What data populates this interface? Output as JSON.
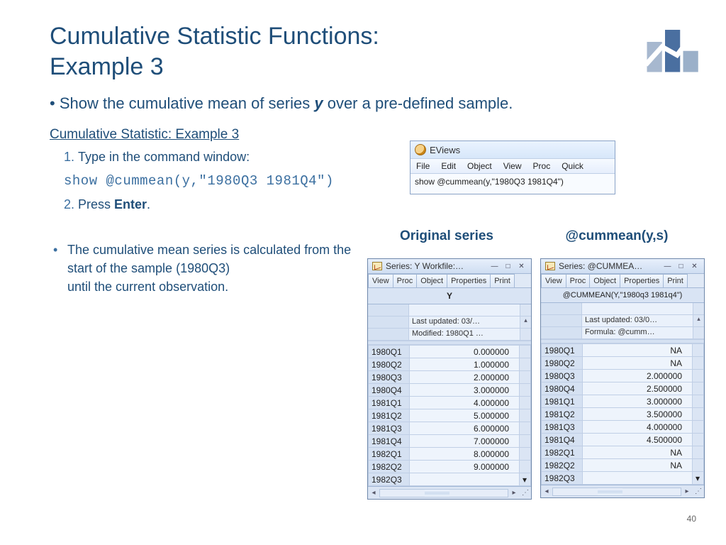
{
  "title_line1": "Cumulative Statistic Functions:",
  "title_line2": "Example 3",
  "main_bullet_pre": "Show the cumulative mean of series ",
  "main_bullet_var": "y",
  "main_bullet_post": " over a pre-defined sample.",
  "sub_heading": "Cumulative Statistic: Example 3",
  "step1": "Type in the command window:",
  "code_line": "show @cummean(y,\"1980Q3 1981Q4\")",
  "step2_pre": "Press ",
  "step2_key": "Enter",
  "step2_post": ".",
  "note_l1": "The cumulative mean series is calculated from the start of the sample (1980Q3)",
  "note_l2": "until the current observation.",
  "page_num": "40",
  "ev_app": "EViews",
  "ev_menu": [
    "File",
    "Edit",
    "Object",
    "View",
    "Proc",
    "Quick"
  ],
  "ev_cmd": "show @cummean(y,\"1980Q3 1981Q4\")",
  "label_left": "Original series",
  "label_right": "@cummean(y,s)",
  "pane_left": {
    "title": "Series: Y   Workfile:…",
    "tabs": [
      "View",
      "Proc",
      "Object",
      "Properties",
      "Print"
    ],
    "header": "Y",
    "meta": [
      "Last updated: 03/…",
      "Modified: 1980Q1 …"
    ],
    "rows": [
      [
        "1980Q1",
        "0.000000"
      ],
      [
        "1980Q2",
        "1.000000"
      ],
      [
        "1980Q3",
        "2.000000"
      ],
      [
        "1980Q4",
        "3.000000"
      ],
      [
        "1981Q1",
        "4.000000"
      ],
      [
        "1981Q2",
        "5.000000"
      ],
      [
        "1981Q3",
        "6.000000"
      ],
      [
        "1981Q4",
        "7.000000"
      ],
      [
        "1982Q1",
        "8.000000"
      ],
      [
        "1982Q2",
        "9.000000"
      ],
      [
        "1982Q3",
        ""
      ]
    ]
  },
  "pane_right": {
    "title": "Series: @CUMMEA…",
    "tabs": [
      "View",
      "Proc",
      "Object",
      "Properties",
      "Print"
    ],
    "header": "@CUMMEAN(Y,\"1980q3 1981q4\")",
    "meta": [
      "Last updated: 03/0…",
      "Formula: @cumm…"
    ],
    "rows": [
      [
        "1980Q1",
        "NA"
      ],
      [
        "1980Q2",
        "NA"
      ],
      [
        "1980Q3",
        "2.000000"
      ],
      [
        "1980Q4",
        "2.500000"
      ],
      [
        "1981Q1",
        "3.000000"
      ],
      [
        "1981Q2",
        "3.500000"
      ],
      [
        "1981Q3",
        "4.000000"
      ],
      [
        "1981Q4",
        "4.500000"
      ],
      [
        "1982Q1",
        "NA"
      ],
      [
        "1982Q2",
        "NA"
      ],
      [
        "1982Q3",
        ""
      ]
    ]
  }
}
